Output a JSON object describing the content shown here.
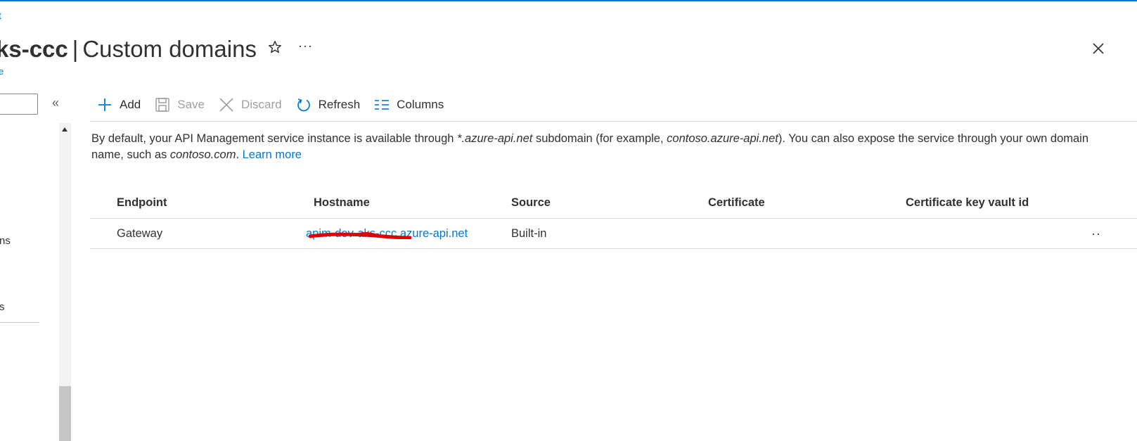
{
  "breadcrumb_fragment": "t",
  "header": {
    "resource_name_fragment": "ks-ccc",
    "separator": "|",
    "page_title": "Custom domains",
    "subtitle_fragment": "e",
    "more_label": "···"
  },
  "sidebar": {
    "collapse_label": "«",
    "visible_fragments": [
      "ns",
      "s"
    ]
  },
  "toolbar": {
    "add_label": "Add",
    "save_label": "Save",
    "discard_label": "Discard",
    "refresh_label": "Refresh",
    "columns_label": "Columns"
  },
  "info": {
    "part1": "By default, your API Management service instance is available through ",
    "domain_pattern": "*.azure-api.net",
    "part2": " subdomain (for example, ",
    "example_domain": "contoso.azure-api.net",
    "part3": "). You can also expose the service through your own domain name, such as ",
    "custom_example": "contoso.com",
    "part4": ". ",
    "learn_more": "Learn more"
  },
  "table": {
    "columns": [
      "Endpoint",
      "Hostname",
      "Source",
      "Certificate",
      "Certificate key vault id"
    ],
    "rows": [
      {
        "endpoint": "Gateway",
        "hostname": "apim-dev-aks-ccc.azure-api.net",
        "source": "Built-in",
        "certificate": "",
        "key_vault_id": "",
        "more": "··"
      }
    ]
  },
  "colors": {
    "accent": "#0078d4",
    "redaction": "#e00000"
  }
}
